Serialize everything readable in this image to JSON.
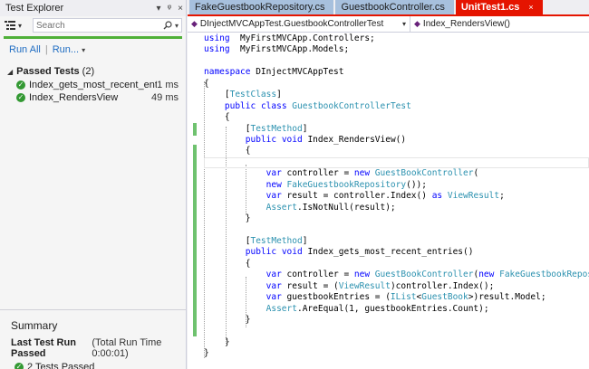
{
  "test_explorer": {
    "title": "Test Explorer",
    "title_controls": [
      "▾",
      "ᵠ",
      "×"
    ],
    "search_placeholder": "Search",
    "run_all": "Run All",
    "run_menu": "Run...",
    "groups": [
      {
        "label": "Passed Tests",
        "count": "(2)",
        "tests": [
          {
            "name": "Index_gets_most_recent_entries",
            "time": "1 ms"
          },
          {
            "name": "Index_RendersView",
            "time": "49 ms"
          }
        ]
      }
    ],
    "summary": {
      "title": "Summary",
      "last_run_label": "Last Test Run Passed",
      "last_run_time": "(Total Run Time 0:00:01)",
      "passed_text": "2 Tests Passed"
    }
  },
  "editor": {
    "tabs": [
      {
        "label": "FakeGuestbookRepository.cs",
        "active": false
      },
      {
        "label": "GuestbookController.cs",
        "active": false
      },
      {
        "label": "UnitTest1.cs",
        "active": true
      }
    ],
    "tab_close": "×",
    "nav_left": "DInjectMVCAppTest.GuestbookControllerTest",
    "nav_right": "Index_RendersView()",
    "code_lines": [
      [
        [
          "kw",
          "using"
        ],
        [
          "",
          "  MyFirstMVCApp.Controllers;"
        ]
      ],
      [
        [
          "kw",
          "using"
        ],
        [
          "",
          "  MyFirstMVCApp.Models;"
        ]
      ],
      [
        [
          "",
          ""
        ]
      ],
      [
        [
          "kw",
          "namespace"
        ],
        [
          "",
          " DInjectMVCAppTest"
        ]
      ],
      [
        [
          "",
          "{"
        ]
      ],
      [
        [
          "",
          "    ["
        ],
        [
          "ty",
          "TestClass"
        ],
        [
          "",
          "]"
        ]
      ],
      [
        [
          "",
          "    "
        ],
        [
          "kw",
          "public"
        ],
        [
          "",
          " "
        ],
        [
          "kw",
          "class"
        ],
        [
          "",
          " "
        ],
        [
          "ty",
          "GuestbookControllerTest"
        ]
      ],
      [
        [
          "",
          "    {"
        ]
      ],
      [
        [
          "",
          "        ["
        ],
        [
          "ty",
          "TestMethod"
        ],
        [
          "",
          "]"
        ]
      ],
      [
        [
          "",
          "        "
        ],
        [
          "kw",
          "public"
        ],
        [
          "",
          " "
        ],
        [
          "kw",
          "void"
        ],
        [
          "",
          " Index_RendersView()"
        ]
      ],
      [
        [
          "",
          "        {"
        ]
      ],
      [
        [
          "",
          ""
        ]
      ],
      [
        [
          "",
          "            "
        ],
        [
          "kw",
          "var"
        ],
        [
          "",
          " controller = "
        ],
        [
          "kw",
          "new"
        ],
        [
          "",
          " "
        ],
        [
          "ty",
          "GuestBookController"
        ],
        [
          "",
          "("
        ]
      ],
      [
        [
          "",
          "            "
        ],
        [
          "kw",
          "new"
        ],
        [
          "",
          " "
        ],
        [
          "ty",
          "FakeGuestbookRepository"
        ],
        [
          "",
          "());"
        ]
      ],
      [
        [
          "",
          "            "
        ],
        [
          "kw",
          "var"
        ],
        [
          "",
          " result = controller.Index() "
        ],
        [
          "kw",
          "as"
        ],
        [
          "",
          " "
        ],
        [
          "ty",
          "ViewResult"
        ],
        [
          "",
          ";"
        ]
      ],
      [
        [
          "",
          "            "
        ],
        [
          "ty",
          "Assert"
        ],
        [
          "",
          ".IsNotNull(result);"
        ]
      ],
      [
        [
          "",
          "        }"
        ]
      ],
      [
        [
          "",
          ""
        ]
      ],
      [
        [
          "",
          "        ["
        ],
        [
          "ty",
          "TestMethod"
        ],
        [
          "",
          "]"
        ]
      ],
      [
        [
          "",
          "        "
        ],
        [
          "kw",
          "public"
        ],
        [
          "",
          " "
        ],
        [
          "kw",
          "void"
        ],
        [
          "",
          " Index_gets_most_recent_entries()"
        ]
      ],
      [
        [
          "",
          "        {"
        ]
      ],
      [
        [
          "",
          "            "
        ],
        [
          "kw",
          "var"
        ],
        [
          "",
          " controller = "
        ],
        [
          "kw",
          "new"
        ],
        [
          "",
          " "
        ],
        [
          "ty",
          "GuestBookController"
        ],
        [
          "",
          "("
        ],
        [
          "kw",
          "new"
        ],
        [
          "",
          " "
        ],
        [
          "ty",
          "FakeGuestbookRepository"
        ],
        [
          "",
          "());"
        ]
      ],
      [
        [
          "",
          "            "
        ],
        [
          "kw",
          "var"
        ],
        [
          "",
          " result = ("
        ],
        [
          "ty",
          "ViewResult"
        ],
        [
          "",
          ")controller.Index();"
        ]
      ],
      [
        [
          "",
          "            "
        ],
        [
          "kw",
          "var"
        ],
        [
          "",
          " guestbookEntries = ("
        ],
        [
          "ty",
          "IList"
        ],
        [
          "",
          "<"
        ],
        [
          "ty",
          "GuestBook"
        ],
        [
          "",
          ">)result.Model;"
        ]
      ],
      [
        [
          "",
          "            "
        ],
        [
          "ty",
          "Assert"
        ],
        [
          "",
          ".AreEqual(1, guestbookEntries.Count);"
        ]
      ],
      [
        [
          "",
          "        }"
        ]
      ],
      [
        [
          "",
          ""
        ]
      ],
      [
        [
          "",
          "    }"
        ]
      ],
      [
        [
          "",
          "}"
        ]
      ]
    ]
  },
  "colors": {
    "accent_tab": "#e51400",
    "passed_green": "#339933",
    "progress_green": "#4fb038",
    "keyword": "#0000ff",
    "type": "#2b91af"
  }
}
